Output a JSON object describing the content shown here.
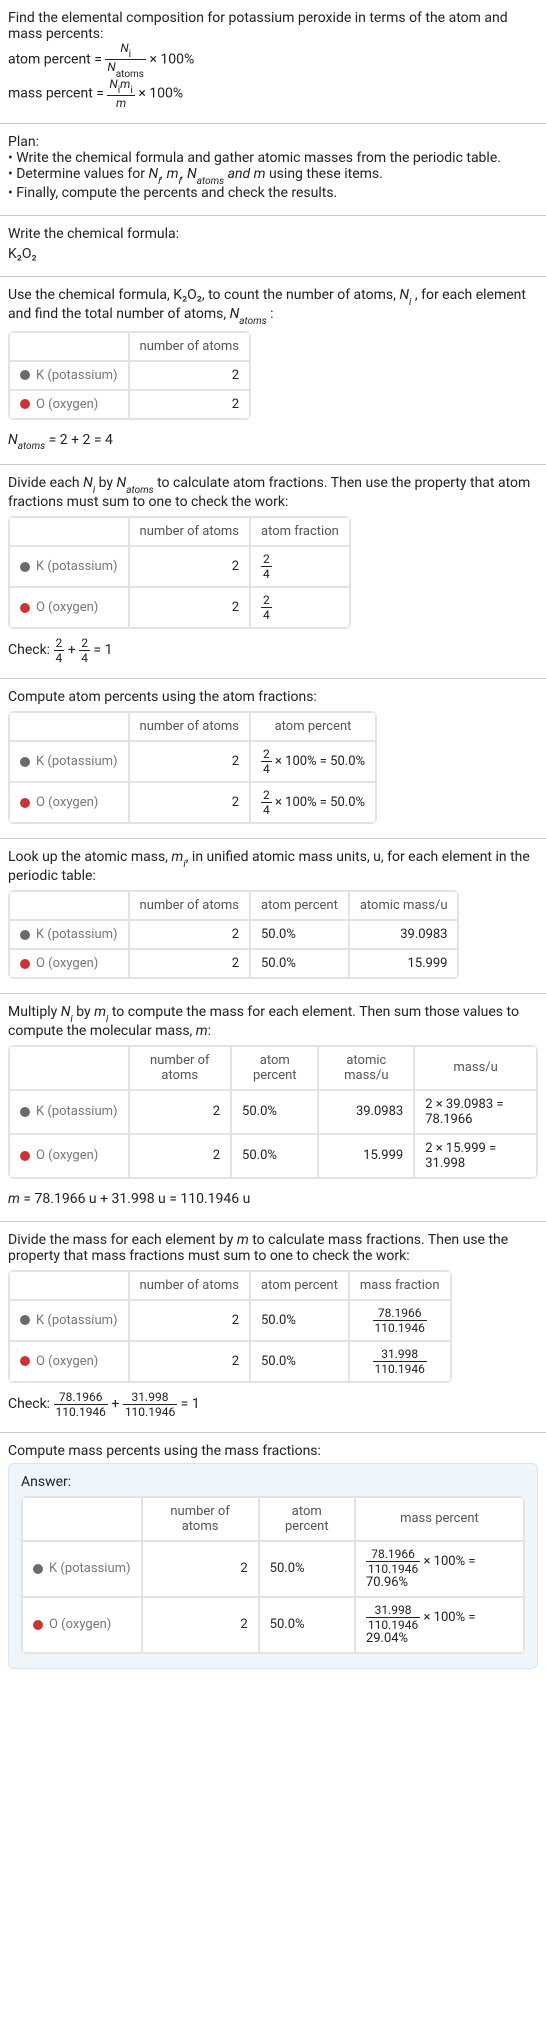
{
  "intro": {
    "line1": "Find the elemental composition for potassium peroxide in terms of the atom and mass percents:",
    "atom_label": "atom percent =",
    "atom_num": "N_i",
    "atom_den": "N_atoms",
    "times100a": "× 100%",
    "mass_label": "mass percent =",
    "mass_num": "N_i m_i",
    "mass_den": "m",
    "times100b": "× 100%"
  },
  "plan": {
    "title": "Plan:",
    "b1": "• Write the chemical formula and gather atomic masses from the periodic table.",
    "b2_a": "• Determine values for ",
    "b2_b": " using these items.",
    "vars": "N_i, m_i, N_atoms and m",
    "b3": "• Finally, compute the percents and check the results."
  },
  "formula": {
    "title": "Write the chemical formula:",
    "text": "K₂O₂"
  },
  "counts": {
    "intro_a": "Use the chemical formula, K₂O₂, to count the number of atoms, ",
    "intro_b": ", for each element and find the total number of atoms, ",
    "intro_c": ":",
    "hdr_atoms": "number of atoms",
    "k_label": "K (potassium)",
    "o_label": "O (oxygen)",
    "k_n": "2",
    "o_n": "2",
    "total": "N_atoms = 2 + 2 = 4"
  },
  "atomfrac": {
    "intro": "Divide each N_i by N_atoms to calculate atom fractions. Then use the property that atom fractions must sum to one to check the work:",
    "hdr_atoms": "number of atoms",
    "hdr_frac": "atom fraction",
    "k_n": "2",
    "k_frac_num": "2",
    "k_frac_den": "4",
    "o_n": "2",
    "o_frac_num": "2",
    "o_frac_den": "4",
    "check": "Check: ",
    "sum_eq": " = 1"
  },
  "atompct": {
    "intro": "Compute atom percents using the atom fractions:",
    "hdr_atoms": "number of atoms",
    "hdr_pct": "atom percent",
    "k_n": "2",
    "k_expr": " × 100% = 50.0%",
    "o_n": "2",
    "o_expr": " × 100% = 50.0%"
  },
  "masses": {
    "intro": "Look up the atomic mass, m_i, in unified atomic mass units, u, for each element in the periodic table:",
    "hdr_atoms": "number of atoms",
    "hdr_pct": "atom percent",
    "hdr_mass": "atomic mass/u",
    "k_n": "2",
    "k_pct": "50.0%",
    "k_mass": "39.0983",
    "o_n": "2",
    "o_pct": "50.0%",
    "o_mass": "15.999"
  },
  "molmass": {
    "intro": "Multiply N_i by m_i to compute the mass for each element. Then sum those values to compute the molecular mass, m:",
    "hdr_atoms": "number of atoms",
    "hdr_pct": "atom percent",
    "hdr_amass": "atomic mass/u",
    "hdr_mass": "mass/u",
    "k_n": "2",
    "k_pct": "50.0%",
    "k_amass": "39.0983",
    "k_mass": "2 × 39.0983 = 78.1966",
    "o_n": "2",
    "o_pct": "50.0%",
    "o_amass": "15.999",
    "o_mass": "2 × 15.999 = 31.998",
    "total": "m = 78.1966 u + 31.998 u = 110.1946 u"
  },
  "massfrac": {
    "intro": "Divide the mass for each element by m to calculate mass fractions. Then use the property that mass fractions must sum to one to check the work:",
    "hdr_atoms": "number of atoms",
    "hdr_pct": "atom percent",
    "hdr_frac": "mass fraction",
    "k_n": "2",
    "k_pct": "50.0%",
    "k_num": "78.1966",
    "k_den": "110.1946",
    "o_n": "2",
    "o_pct": "50.0%",
    "o_num": "31.998",
    "o_den": "110.1946",
    "check": "Check: ",
    "sum_eq": " = 1"
  },
  "masspct": {
    "intro": "Compute mass percents using the mass fractions:",
    "answer": "Answer:",
    "hdr_atoms": "number of atoms",
    "hdr_pct": "atom percent",
    "hdr_mpct": "mass percent",
    "k_n": "2",
    "k_pct": "50.0%",
    "k_num": "78.1966",
    "k_den": "110.1946",
    "k_tail": " × 100% = 70.96%",
    "o_n": "2",
    "o_pct": "50.0%",
    "o_num": "31.998",
    "o_den": "110.1946",
    "o_tail": " × 100% = 29.04%"
  }
}
